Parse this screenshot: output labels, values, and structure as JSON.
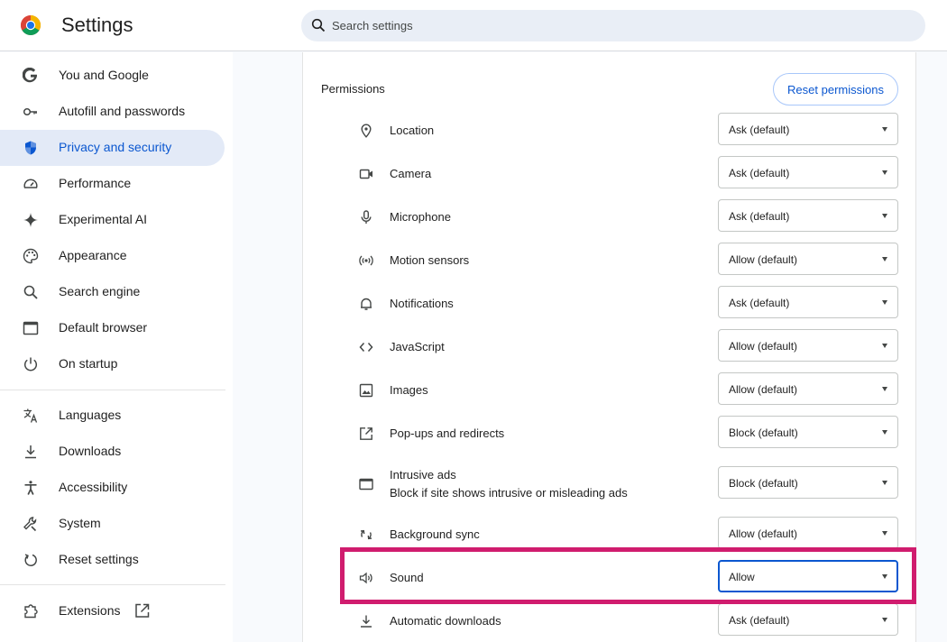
{
  "app": {
    "title": "Settings",
    "logo_icon": "chrome-logo-icon"
  },
  "search": {
    "placeholder": "Search settings",
    "value": ""
  },
  "sidebar": {
    "items": [
      {
        "label": "You and Google",
        "icon": "google-g-icon"
      },
      {
        "label": "Autofill and passwords",
        "icon": "key-icon"
      },
      {
        "label": "Privacy and security",
        "icon": "shield-icon",
        "active": true
      },
      {
        "label": "Performance",
        "icon": "speedometer-icon"
      },
      {
        "label": "Experimental AI",
        "icon": "sparkle-icon"
      },
      {
        "label": "Appearance",
        "icon": "palette-icon"
      },
      {
        "label": "Search engine",
        "icon": "search-icon"
      },
      {
        "label": "Default browser",
        "icon": "browser-window-icon"
      },
      {
        "label": "On startup",
        "icon": "power-icon"
      },
      {
        "label": "Languages",
        "icon": "translate-icon"
      },
      {
        "label": "Downloads",
        "icon": "download-icon"
      },
      {
        "label": "Accessibility",
        "icon": "accessibility-icon"
      },
      {
        "label": "System",
        "icon": "wrench-icon"
      },
      {
        "label": "Reset settings",
        "icon": "reset-icon"
      },
      {
        "label": "Extensions",
        "icon": "puzzle-icon"
      }
    ]
  },
  "permissions": {
    "title": "Permissions",
    "reset_label": "Reset permissions",
    "rows": [
      {
        "label": "Location",
        "value": "Ask (default)",
        "icon": "location-pin-icon"
      },
      {
        "label": "Camera",
        "value": "Ask (default)",
        "icon": "camera-icon"
      },
      {
        "label": "Microphone",
        "value": "Ask (default)",
        "icon": "microphone-icon"
      },
      {
        "label": "Motion sensors",
        "value": "Allow (default)",
        "icon": "motion-sensors-icon"
      },
      {
        "label": "Notifications",
        "value": "Ask (default)",
        "icon": "bell-icon"
      },
      {
        "label": "JavaScript",
        "value": "Allow (default)",
        "icon": "code-icon"
      },
      {
        "label": "Images",
        "value": "Allow (default)",
        "icon": "image-icon"
      },
      {
        "label": "Pop-ups and redirects",
        "value": "Block (default)",
        "icon": "open-external-icon"
      },
      {
        "label": "Intrusive ads",
        "sublabel": "Block if site shows intrusive or misleading ads",
        "value": "Block (default)",
        "icon": "ad-window-icon"
      },
      {
        "label": "Background sync",
        "value": "Allow (default)",
        "icon": "sync-icon"
      },
      {
        "label": "Sound",
        "value": "Allow",
        "icon": "speaker-icon",
        "highlighted": true
      },
      {
        "label": "Automatic downloads",
        "value": "Ask (default)",
        "icon": "download-icon"
      }
    ]
  },
  "colors": {
    "accent": "#0b57d0",
    "highlight": "#d01c6e",
    "active_bg": "#e3eaf7"
  }
}
